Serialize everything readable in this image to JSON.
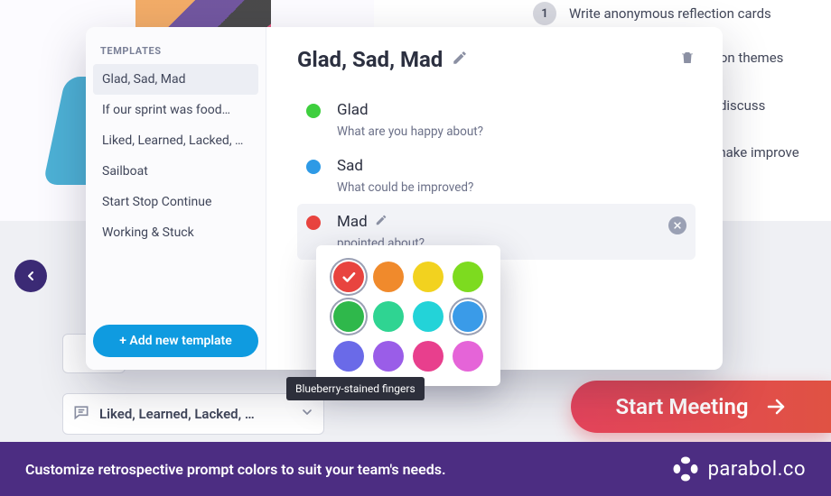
{
  "background_steps": {
    "s1": {
      "num": "1",
      "text": "Write anonymous reflection cards"
    },
    "s2": {
      "text": "ommon themes"
    },
    "s3": {
      "text": "nt to discuss"
    },
    "s4": {
      "text": "s to make improve"
    }
  },
  "card_below_label": "Liked, Learned, Lacked, …",
  "start_button_label": "Start Meeting",
  "footer_text": "Customize retrospective prompt colors to suit your team's needs.",
  "brand_text": "parabol.co",
  "templates_header": "TEMPLATES",
  "templates": [
    "Glad, Sad, Mad",
    "If our sprint was food…",
    "Liked, Learned, Lacked, …",
    "Sailboat",
    "Start Stop Continue",
    "Working & Stuck"
  ],
  "add_template_label": "+ Add new template",
  "current_template_title": "Glad, Sad, Mad",
  "prompts": [
    {
      "name": "Glad",
      "desc": "What are you happy about?",
      "color": "#3ecf3e"
    },
    {
      "name": "Sad",
      "desc": "What could be improved?",
      "color": "#2e9ae6"
    },
    {
      "name": "Mad",
      "desc": "ppointed about?",
      "color": "#e8443f"
    }
  ],
  "picker_colors": [
    {
      "hex": "#e8443f",
      "selected": true,
      "ring": true
    },
    {
      "hex": "#f08a2c"
    },
    {
      "hex": "#f2d21f"
    },
    {
      "hex": "#7ddb1f"
    },
    {
      "hex": "#2fb84b",
      "ring": true
    },
    {
      "hex": "#2fd492"
    },
    {
      "hex": "#23d3d8"
    },
    {
      "hex": "#3a9be8",
      "ring": true
    },
    {
      "hex": "#6a6ae8"
    },
    {
      "hex": "#9a5de8"
    },
    {
      "hex": "#e83f8d"
    },
    {
      "hex": "#e564d8"
    }
  ],
  "tooltip_text": "Blueberry-stained fingers"
}
